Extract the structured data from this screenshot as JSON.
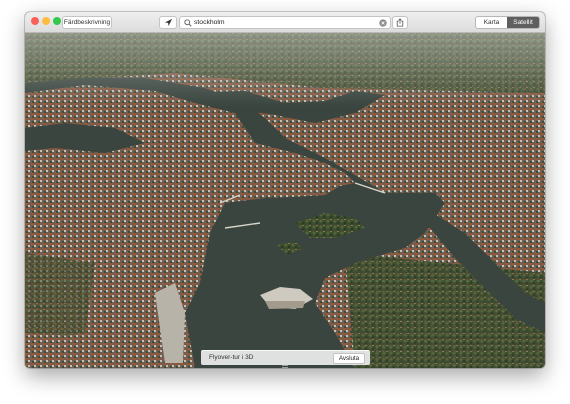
{
  "toolbar": {
    "directions_label": "Färdbeskrivning",
    "search_value": "stockholm",
    "map_mode": {
      "map_label": "Karta",
      "satellite_label": "Satellit",
      "selected": "Satellit"
    }
  },
  "flyover": {
    "title": "Flyover-tur i 3D",
    "end_label": "Avsluta"
  },
  "colors": {
    "close": "#fc605b",
    "minimize": "#fdbc40",
    "zoom": "#34c84a",
    "segment_selected": "#5f5f5f",
    "water": "#39443e"
  },
  "icons": {
    "location": "location-arrow-icon",
    "search": "search-icon",
    "clear": "clear-search-icon",
    "share": "share-icon",
    "flyover_grip": "grip-icon"
  }
}
